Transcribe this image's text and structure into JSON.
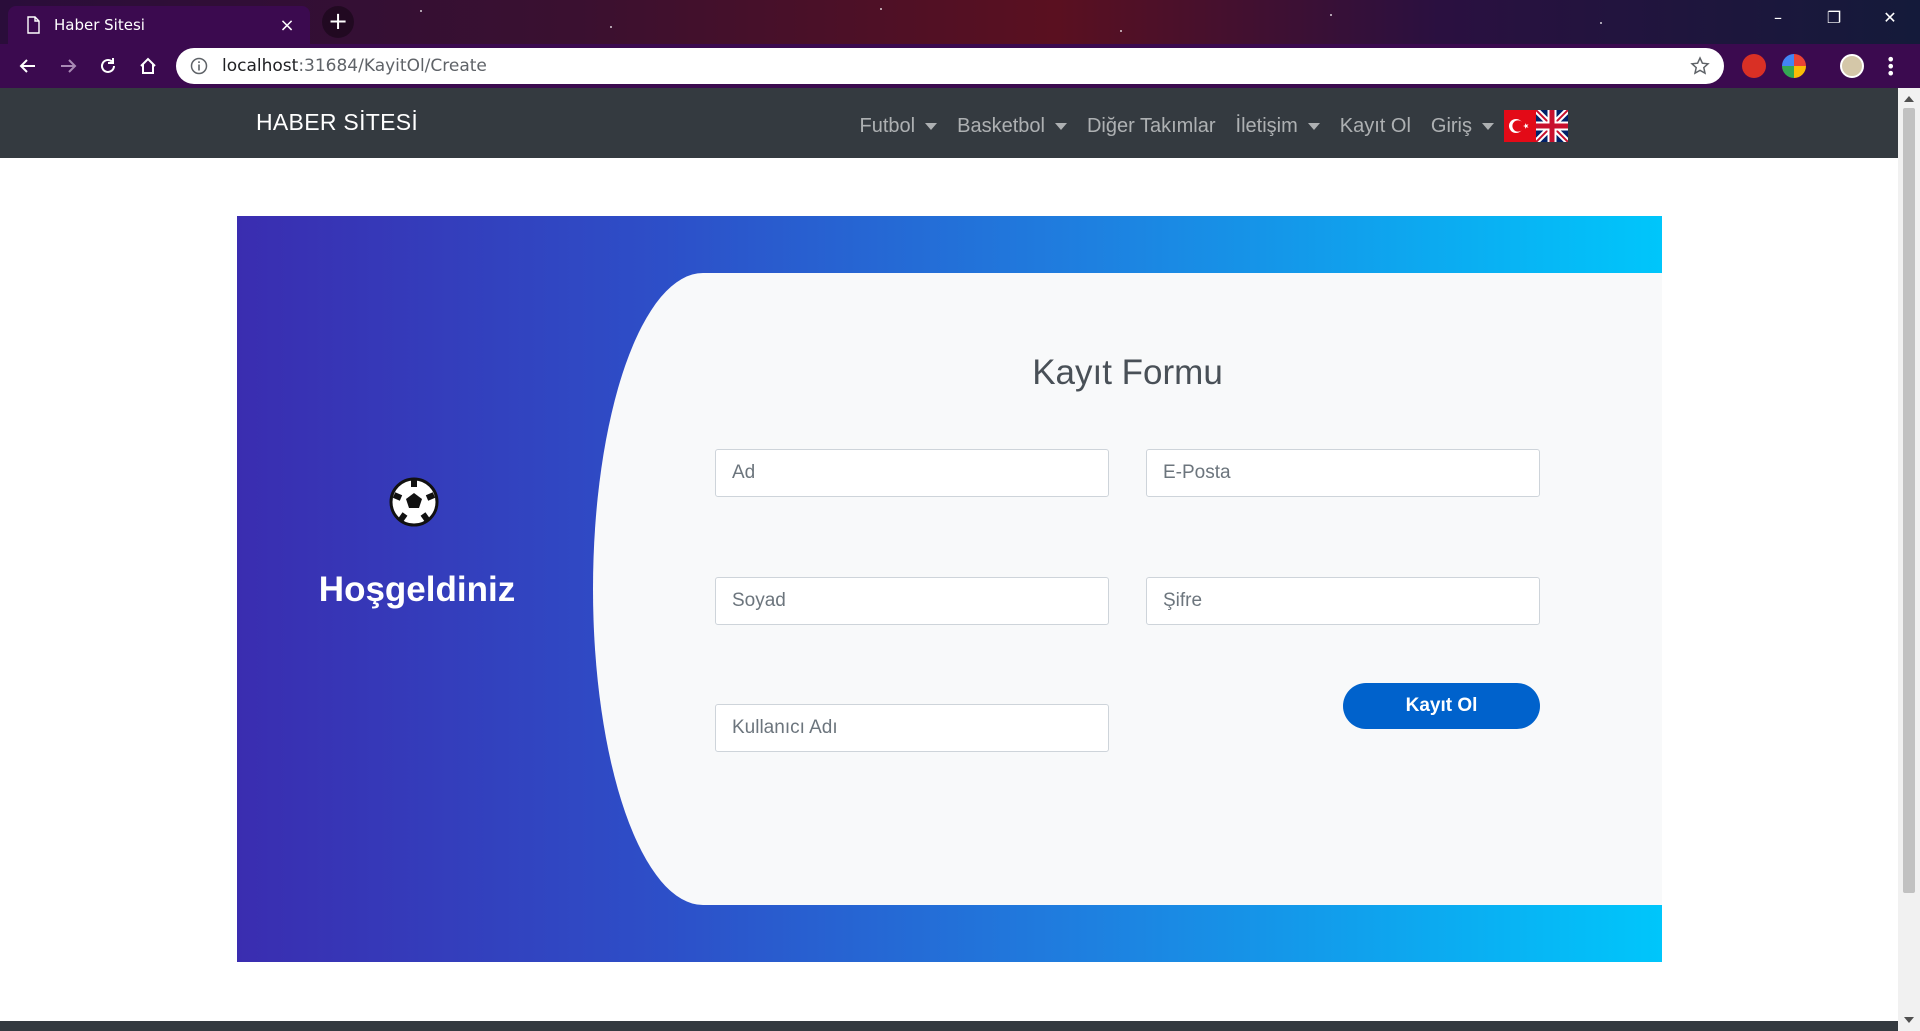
{
  "browser": {
    "tab_title": "Haber Sitesi",
    "tab_close": "×",
    "new_tab": "+",
    "url_host": "localhost",
    "url_path": ":31684/KayitOl/Create",
    "window_controls": {
      "minimize": "–",
      "restore": "❐",
      "close": "✕"
    }
  },
  "navbar": {
    "brand": "HABER SİTESİ",
    "items": [
      {
        "label": "Futbol",
        "dropdown": true
      },
      {
        "label": "Basketbol",
        "dropdown": true
      },
      {
        "label": "Diğer Takımlar",
        "dropdown": false
      },
      {
        "label": "İletişim",
        "dropdown": true
      },
      {
        "label": "Kayıt Ol",
        "dropdown": false
      },
      {
        "label": "Giriş",
        "dropdown": true
      }
    ],
    "flags": [
      "turkey-flag-icon",
      "uk-flag-icon"
    ]
  },
  "card": {
    "welcome": "Hoşgeldiniz",
    "icon": "soccer-ball-icon",
    "form_title": "Kayıt Formu",
    "fields": {
      "first_name_placeholder": "Ad",
      "email_placeholder": "E-Posta",
      "last_name_placeholder": "Soyad",
      "password_placeholder": "Şifre",
      "username_placeholder": "Kullanıcı Adı"
    },
    "submit_label": "Kayıt Ol"
  },
  "colors": {
    "gradient_start": "#3a2db0",
    "gradient_end": "#00c6fb",
    "navbar_bg": "#343a40",
    "button_bg": "#0062cc",
    "browser_chrome": "#3b0a4f"
  }
}
